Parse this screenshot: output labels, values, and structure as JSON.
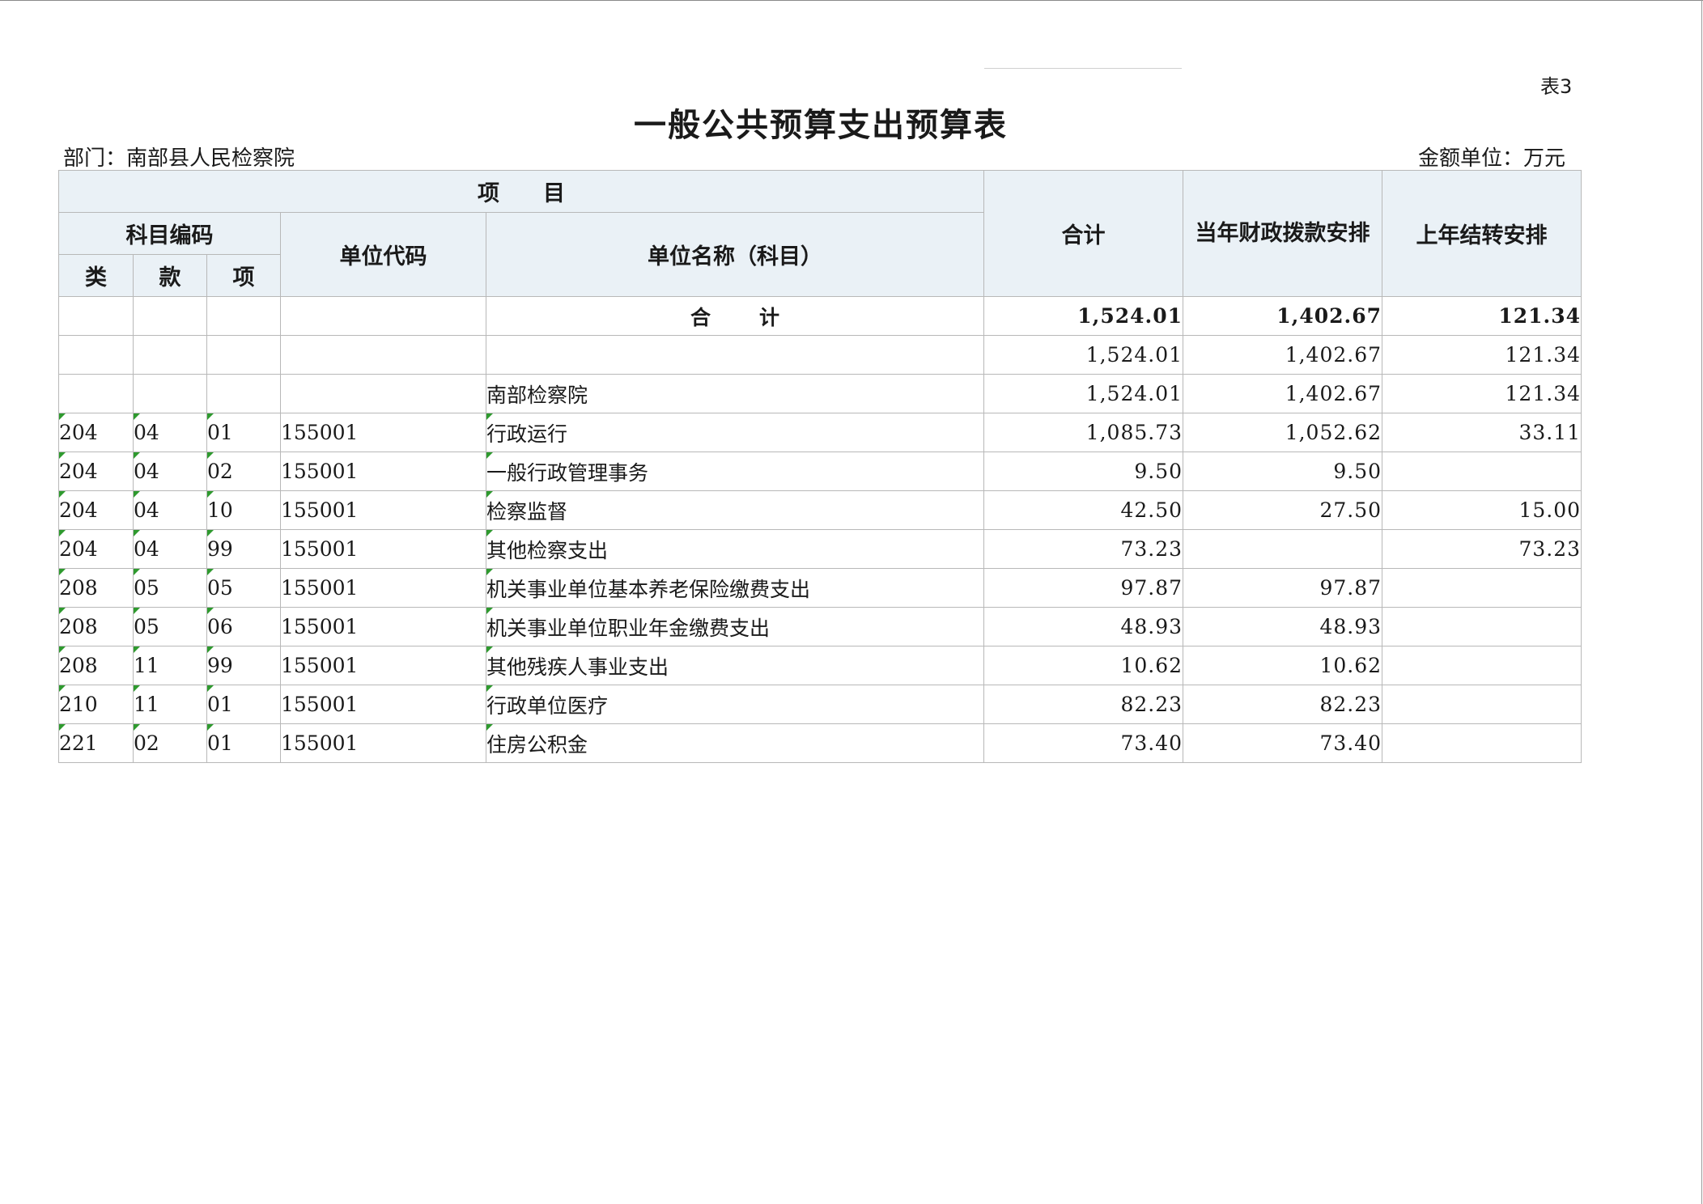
{
  "page": {
    "table_no": "表3",
    "title": "一般公共预算支出预算表",
    "department": "部门：南部县人民检察院",
    "unit": "金额单位：万元"
  },
  "headers": {
    "project": "项　　目",
    "subject_code": "科目编码",
    "lei": "类",
    "kuan": "款",
    "xiang": "项",
    "unit_code": "单位代码",
    "unit_name": "单位名称（科目）",
    "total": "合计",
    "current_year": "当年财政拨款安排",
    "last_year": "上年结转安排"
  },
  "total_row": {
    "label": "合计",
    "total": "1,524.01",
    "current": "1,402.67",
    "carry": "121.34"
  },
  "rows": [
    {
      "lei": "",
      "kuan": "",
      "xiang": "",
      "code": "",
      "name": "",
      "total": "1,524.01",
      "current": "1,402.67",
      "carry": "121.34",
      "flag": false
    },
    {
      "lei": "",
      "kuan": "",
      "xiang": "",
      "code": "",
      "name": "南部检察院",
      "total": "1,524.01",
      "current": "1,402.67",
      "carry": "121.34",
      "flag": false
    },
    {
      "lei": "204",
      "kuan": "04",
      "xiang": "01",
      "code": "155001",
      "name": "行政运行",
      "total": "1,085.73",
      "current": "1,052.62",
      "carry": "33.11",
      "flag": true
    },
    {
      "lei": "204",
      "kuan": "04",
      "xiang": "02",
      "code": "155001",
      "name": "一般行政管理事务",
      "total": "9.50",
      "current": "9.50",
      "carry": "",
      "flag": true
    },
    {
      "lei": "204",
      "kuan": "04",
      "xiang": "10",
      "code": "155001",
      "name": "检察监督",
      "total": "42.50",
      "current": "27.50",
      "carry": "15.00",
      "flag": true
    },
    {
      "lei": "204",
      "kuan": "04",
      "xiang": "99",
      "code": "155001",
      "name": "其他检察支出",
      "total": "73.23",
      "current": "",
      "carry": "73.23",
      "flag": true
    },
    {
      "lei": "208",
      "kuan": "05",
      "xiang": "05",
      "code": "155001",
      "name": "机关事业单位基本养老保险缴费支出",
      "total": "97.87",
      "current": "97.87",
      "carry": "",
      "flag": true
    },
    {
      "lei": "208",
      "kuan": "05",
      "xiang": "06",
      "code": "155001",
      "name": "机关事业单位职业年金缴费支出",
      "total": "48.93",
      "current": "48.93",
      "carry": "",
      "flag": true
    },
    {
      "lei": "208",
      "kuan": "11",
      "xiang": "99",
      "code": "155001",
      "name": "其他残疾人事业支出",
      "total": "10.62",
      "current": "10.62",
      "carry": "",
      "flag": true
    },
    {
      "lei": "210",
      "kuan": "11",
      "xiang": "01",
      "code": "155001",
      "name": "行政单位医疗",
      "total": "82.23",
      "current": "82.23",
      "carry": "",
      "flag": true
    },
    {
      "lei": "221",
      "kuan": "02",
      "xiang": "01",
      "code": "155001",
      "name": "住房公积金",
      "total": "73.40",
      "current": "73.40",
      "carry": "",
      "flag": true
    }
  ],
  "colors": {
    "header_bg": "#eaf1f6",
    "grid": "#b8b8b8",
    "flag": "#2e9a2e"
  }
}
